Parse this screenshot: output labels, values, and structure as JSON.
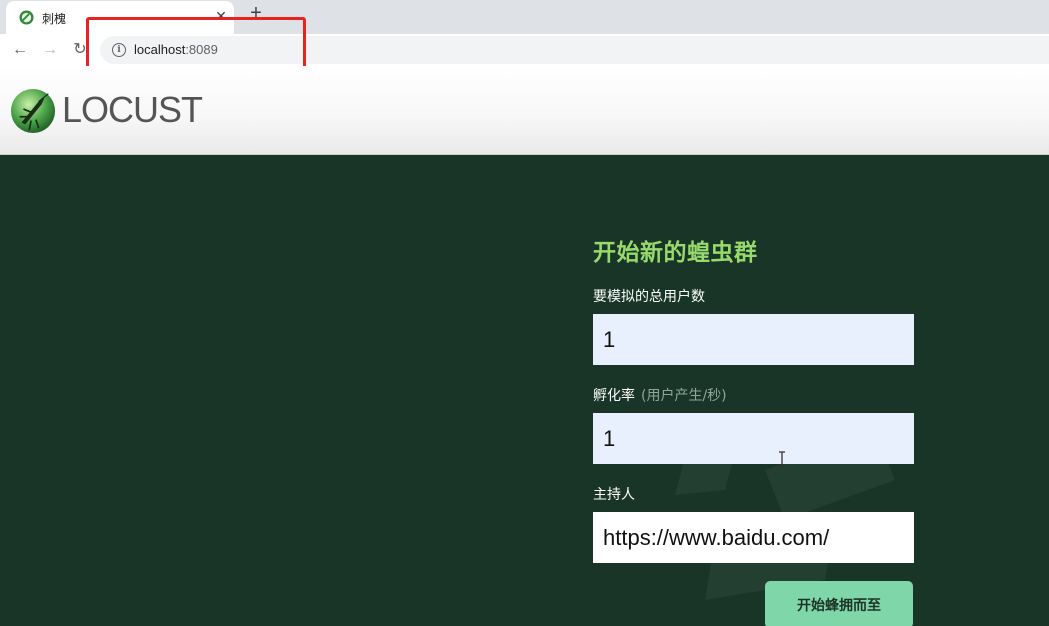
{
  "browser": {
    "tab": {
      "title": "刺槐",
      "close_glyph": "✕",
      "favicon": "locust-favicon-icon"
    },
    "new_tab_glyph": "+",
    "nav": {
      "back_glyph": "←",
      "forward_glyph": "→",
      "reload_glyph": "↻"
    },
    "address": {
      "host": "localhost",
      "port": ":8089",
      "info_glyph": "i"
    },
    "annotation_color": "#e8231f"
  },
  "header": {
    "logo_text": "LOCUST"
  },
  "form": {
    "title": "开始新的蝗虫群",
    "users_label": "要模拟的总用户数",
    "users_value": "1",
    "rate_label": "孵化率",
    "rate_hint": "(用户产生/秒)",
    "rate_value": "1",
    "host_label": "主持人",
    "host_value": "https://www.baidu.com/",
    "submit_label": "开始蜂拥而至"
  },
  "colors": {
    "background": "#193528",
    "title": "#97d96b",
    "button": "#7fd6a8",
    "autofill": "#e8f0fe"
  }
}
